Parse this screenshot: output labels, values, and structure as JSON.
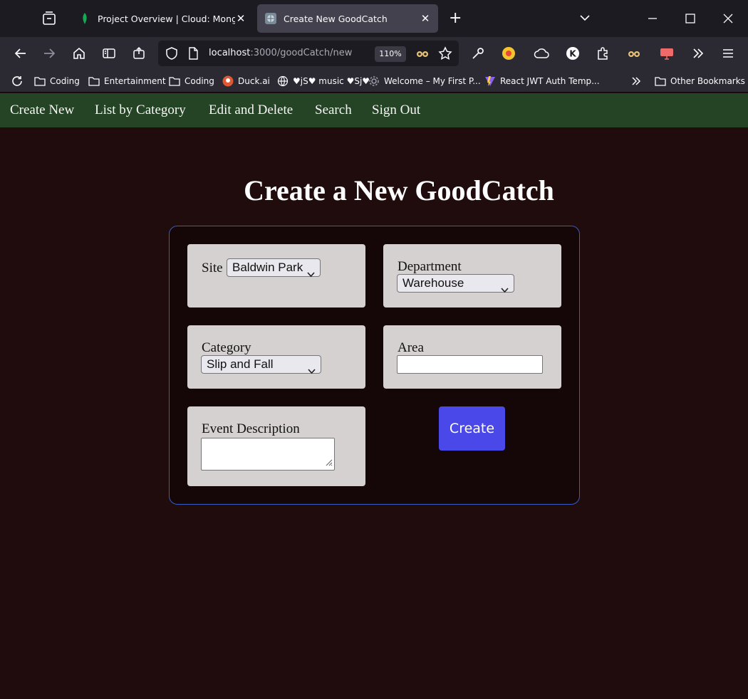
{
  "browser": {
    "tabs": [
      {
        "title": "Project Overview | Cloud: MongoDB",
        "active": false,
        "favicon": "mongodb-leaf-icon"
      },
      {
        "title": "Create New GoodCatch",
        "active": true,
        "favicon": "globe-app-icon"
      }
    ],
    "url": {
      "host": "localhost",
      "path": ":3000/goodCatch/new"
    },
    "zoom": "110%",
    "bookmarks": [
      {
        "label": "Coding",
        "icon": "folder-icon"
      },
      {
        "label": "Entertainment",
        "icon": "folder-icon"
      },
      {
        "label": "Coding",
        "icon": "folder-icon"
      },
      {
        "label": "Duck.ai",
        "icon": "duck-icon"
      },
      {
        "label": "♥jS♥ music ♥Sj♥",
        "icon": "globe-icon"
      },
      {
        "label": "Welcome – My First P...",
        "icon": "gear-icon"
      },
      {
        "label": "React JWT Auth Temp...",
        "icon": "vite-icon"
      },
      {
        "label": "Other Bookmarks",
        "icon": "folder-icon"
      }
    ]
  },
  "nav": {
    "create_new": "Create New",
    "list_by_category": "List by Category",
    "edit_and_delete": "Edit and Delete",
    "search": "Search",
    "sign_out": "Sign Out"
  },
  "page": {
    "title": "Create a New GoodCatch"
  },
  "form": {
    "site": {
      "label": "Site",
      "value": "Baldwin Park"
    },
    "department": {
      "label": "Department",
      "value": "Warehouse"
    },
    "category": {
      "label": "Category",
      "value": "Slip and Fall"
    },
    "area": {
      "label": "Area",
      "value": ""
    },
    "event_description": {
      "label": "Event Description",
      "value": ""
    },
    "submit_label": "Create"
  },
  "colors": {
    "app_nav_bg": "#254325",
    "page_bg": "#200c0c",
    "form_border": "#3b5cc0",
    "button_bg": "#4a48e8"
  }
}
